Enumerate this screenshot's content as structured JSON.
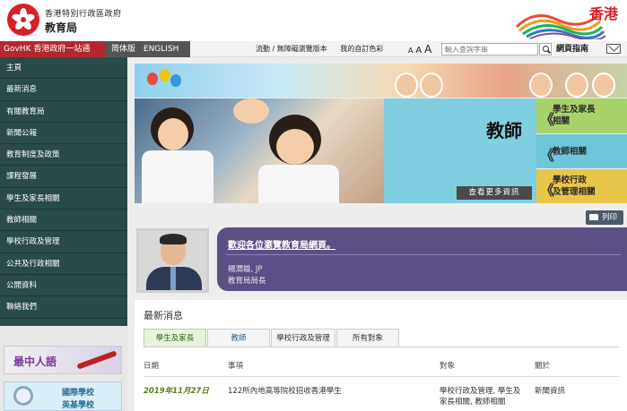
{
  "header": {
    "gov_name": "香港特別行政區政府",
    "bureau": "教育局",
    "brand_text": "香港"
  },
  "navbar": {
    "govhk": "GovHK 香港政府一站通",
    "lang_simplified": "简体版",
    "lang_english": "ENGLISH",
    "mobile_link": "流動 / 無障礙瀏覽版本",
    "my_colour": "我的自訂色彩",
    "font_small": "A",
    "font_medium": "A",
    "font_large": "A",
    "search_placeholder": "輸入查詢字串",
    "web_guide": "網頁指南"
  },
  "sidebar": {
    "items": [
      {
        "label": "主頁"
      },
      {
        "label": "最新消息"
      },
      {
        "label": "有關教育局"
      },
      {
        "label": "新聞公報"
      },
      {
        "label": "教育制度及政策"
      },
      {
        "label": "課程發展"
      },
      {
        "label": "學生及家長相關"
      },
      {
        "label": "教師相關"
      },
      {
        "label": "學校行政及管理"
      },
      {
        "label": "公共及行政相關"
      },
      {
        "label": "公開資料"
      },
      {
        "label": "聯絡我們"
      }
    ],
    "ad1_text": "最中人語",
    "ad2_line1": "國際學校",
    "ad2_line2": "英基學校"
  },
  "banner": {
    "title": "教師",
    "more_button": "查看更多資訊",
    "categories": [
      {
        "line1": "學生及家長",
        "line2": "相關"
      },
      {
        "line1": "教師相關",
        "line2": ""
      },
      {
        "line1": "學校行政",
        "line2": "及管理相關"
      }
    ]
  },
  "print_label": "列印",
  "welcome": {
    "title": "歡迎各位瀏覽教育局網頁。",
    "name": "楊潤雄, JP",
    "role": "教育局局長"
  },
  "news": {
    "heading": "最新消息",
    "tabs": [
      "學生及家長",
      "教師",
      "學校行政及管理",
      "所有對象"
    ],
    "columns": {
      "date": "日期",
      "item": "事項",
      "target": "對象",
      "category": "關於"
    },
    "rows": [
      {
        "date": "2019年11月27日",
        "item": "122所內地高等院校招收香港學生",
        "target_line1": "學校行政及管理, 學生及",
        "target_line2": "家長相關, 教師相關",
        "category": "新聞資訊"
      }
    ]
  },
  "colors": {
    "govhk_red": "#b3282d",
    "sidebar_bg": "#2b4a4a",
    "welcome_purple": "#5c4f86",
    "cat_green": "#a8d36a",
    "cat_blue": "#6fc6d9",
    "cat_yellow": "#e9c649"
  }
}
